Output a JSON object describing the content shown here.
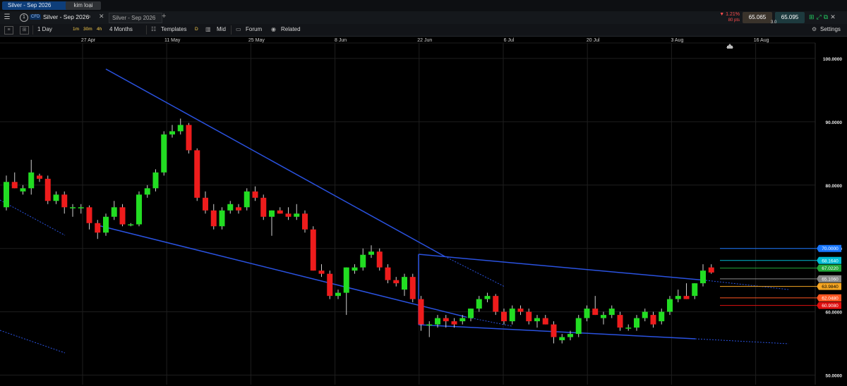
{
  "tabs": {
    "active": "Silver - Sep 2026",
    "inactive": "kim loại"
  },
  "header": {
    "menu_icon": "menu-icon",
    "info_label": "1",
    "instrument_type": "CFD",
    "instrument": "Silver - Sep 2026",
    "compare_placeholder": "Silver - Sep 2026",
    "change_pct": "▼ 1.21%",
    "change_pts": "80 pts",
    "bid": "65.065",
    "ask": "65.095",
    "spread": "3.0"
  },
  "toolbar": {
    "interval": "1 Day",
    "tf_1m": "1m",
    "tf_30m": "30m",
    "tf_4h": "4h",
    "range": "4 Months",
    "templates": "Templates",
    "d_label": "D",
    "mid": "Mid",
    "forum": "Forum",
    "related": "Related",
    "settings": "Settings"
  },
  "colors": {
    "up": "#22dd22",
    "down": "#ee1c1c",
    "trend": "#2a52e0",
    "grid": "#1e1e1e"
  },
  "chart_data": {
    "type": "candlestick",
    "x_ticks": [
      "27 Apr",
      "11 May",
      "25 May",
      "8 Jun",
      "22 Jun",
      "6 Jul",
      "20 Jul",
      "3 Aug",
      "16 Aug"
    ],
    "y_ticks": [
      "100.0000",
      "90.0000",
      "80.0000",
      "70.0000",
      "60.0000",
      "50.0000"
    ],
    "ylim": [
      48.5,
      102
    ],
    "candles": [
      {
        "o": 76.5,
        "h": 81.5,
        "l": 76.0,
        "c": 80.5
      },
      {
        "o": 80.5,
        "h": 82.0,
        "l": 79.5,
        "c": 79.5
      },
      {
        "o": 79.0,
        "h": 80.0,
        "l": 78.5,
        "c": 79.5
      },
      {
        "o": 79.5,
        "h": 84.0,
        "l": 78.5,
        "c": 82.0
      },
      {
        "o": 81.5,
        "h": 81.8,
        "l": 80.5,
        "c": 81.0
      },
      {
        "o": 81.0,
        "h": 81.5,
        "l": 77.0,
        "c": 77.5
      },
      {
        "o": 77.5,
        "h": 79.0,
        "l": 77.0,
        "c": 78.5
      },
      {
        "o": 78.5,
        "h": 79.0,
        "l": 75.5,
        "c": 76.5
      },
      {
        "o": 76.5,
        "h": 77.0,
        "l": 75.0,
        "c": 76.5
      },
      {
        "o": 76.5,
        "h": 77.0,
        "l": 75.5,
        "c": 76.5
      },
      {
        "o": 76.5,
        "h": 76.8,
        "l": 73.0,
        "c": 74.0
      },
      {
        "o": 74.0,
        "h": 74.5,
        "l": 71.5,
        "c": 72.5
      },
      {
        "o": 72.5,
        "h": 75.5,
        "l": 72.0,
        "c": 75.0
      },
      {
        "o": 75.0,
        "h": 77.5,
        "l": 74.5,
        "c": 76.5
      },
      {
        "o": 76.5,
        "h": 77.0,
        "l": 73.5,
        "c": 73.8
      },
      {
        "o": 73.8,
        "h": 74.0,
        "l": 73.5,
        "c": 73.8
      },
      {
        "o": 73.8,
        "h": 79.0,
        "l": 73.5,
        "c": 78.5
      },
      {
        "o": 78.5,
        "h": 80.0,
        "l": 78.0,
        "c": 79.5
      },
      {
        "o": 79.5,
        "h": 82.5,
        "l": 79.0,
        "c": 82.0
      },
      {
        "o": 82.0,
        "h": 88.5,
        "l": 81.5,
        "c": 88.0
      },
      {
        "o": 88.0,
        "h": 89.5,
        "l": 87.5,
        "c": 88.5
      },
      {
        "o": 88.5,
        "h": 90.5,
        "l": 88.0,
        "c": 89.5
      },
      {
        "o": 89.5,
        "h": 89.8,
        "l": 85.0,
        "c": 85.5
      },
      {
        "o": 85.5,
        "h": 85.8,
        "l": 77.5,
        "c": 78.0
      },
      {
        "o": 78.0,
        "h": 79.0,
        "l": 75.5,
        "c": 76.0
      },
      {
        "o": 76.0,
        "h": 77.0,
        "l": 73.0,
        "c": 73.5
      },
      {
        "o": 73.5,
        "h": 76.5,
        "l": 73.0,
        "c": 76.0
      },
      {
        "o": 76.0,
        "h": 77.5,
        "l": 75.5,
        "c": 77.0
      },
      {
        "o": 76.5,
        "h": 77.0,
        "l": 75.5,
        "c": 76.0
      },
      {
        "o": 76.5,
        "h": 79.5,
        "l": 76.0,
        "c": 79.0
      },
      {
        "o": 79.0,
        "h": 79.8,
        "l": 77.5,
        "c": 78.0
      },
      {
        "o": 78.0,
        "h": 78.5,
        "l": 74.5,
        "c": 75.0
      },
      {
        "o": 75.0,
        "h": 76.0,
        "l": 72.0,
        "c": 76.0
      },
      {
        "o": 76.0,
        "h": 76.5,
        "l": 75.5,
        "c": 75.5
      },
      {
        "o": 75.5,
        "h": 76.5,
        "l": 74.5,
        "c": 75.0
      },
      {
        "o": 75.0,
        "h": 77.0,
        "l": 74.5,
        "c": 75.5
      },
      {
        "o": 75.5,
        "h": 76.0,
        "l": 72.5,
        "c": 73.0
      },
      {
        "o": 73.0,
        "h": 73.5,
        "l": 66.5,
        "c": 66.5
      },
      {
        "o": 66.5,
        "h": 67.5,
        "l": 65.5,
        "c": 66.0
      },
      {
        "o": 66.0,
        "h": 66.5,
        "l": 62.0,
        "c": 62.5
      },
      {
        "o": 62.5,
        "h": 63.5,
        "l": 62.0,
        "c": 63.0
      },
      {
        "o": 63.0,
        "h": 67.0,
        "l": 59.5,
        "c": 67.0
      },
      {
        "o": 66.5,
        "h": 67.5,
        "l": 66.0,
        "c": 67.0
      },
      {
        "o": 67.0,
        "h": 70.0,
        "l": 66.5,
        "c": 69.0
      },
      {
        "o": 69.0,
        "h": 70.5,
        "l": 68.5,
        "c": 69.5
      },
      {
        "o": 69.5,
        "h": 70.0,
        "l": 66.5,
        "c": 67.0
      },
      {
        "o": 67.0,
        "h": 67.5,
        "l": 64.5,
        "c": 65.0
      },
      {
        "o": 65.0,
        "h": 65.5,
        "l": 64.0,
        "c": 64.5
      },
      {
        "o": 63.5,
        "h": 66.0,
        "l": 62.5,
        "c": 65.5
      },
      {
        "o": 65.5,
        "h": 66.0,
        "l": 61.5,
        "c": 62.0
      },
      {
        "o": 62.0,
        "h": 62.5,
        "l": 57.0,
        "c": 58.0
      },
      {
        "o": 58.0,
        "h": 58.5,
        "l": 56.0,
        "c": 58.0
      },
      {
        "o": 58.0,
        "h": 59.5,
        "l": 57.5,
        "c": 59.0
      },
      {
        "o": 59.0,
        "h": 59.5,
        "l": 57.5,
        "c": 58.5
      },
      {
        "o": 58.5,
        "h": 59.0,
        "l": 57.5,
        "c": 58.0
      },
      {
        "o": 58.5,
        "h": 59.5,
        "l": 58.0,
        "c": 59.0
      },
      {
        "o": 59.0,
        "h": 60.5,
        "l": 58.5,
        "c": 60.5
      },
      {
        "o": 60.5,
        "h": 62.5,
        "l": 60.0,
        "c": 62.0
      },
      {
        "o": 62.0,
        "h": 63.0,
        "l": 61.5,
        "c": 62.5
      },
      {
        "o": 62.5,
        "h": 62.8,
        "l": 59.5,
        "c": 60.0
      },
      {
        "o": 60.0,
        "h": 60.5,
        "l": 58.0,
        "c": 58.5
      },
      {
        "o": 58.5,
        "h": 61.0,
        "l": 58.0,
        "c": 60.5
      },
      {
        "o": 60.5,
        "h": 61.0,
        "l": 59.5,
        "c": 60.0
      },
      {
        "o": 60.0,
        "h": 60.5,
        "l": 58.0,
        "c": 58.5
      },
      {
        "o": 58.5,
        "h": 59.5,
        "l": 57.5,
        "c": 59.0
      },
      {
        "o": 59.0,
        "h": 59.5,
        "l": 58.0,
        "c": 58.0
      },
      {
        "o": 58.0,
        "h": 58.5,
        "l": 55.0,
        "c": 56.0
      },
      {
        "o": 55.5,
        "h": 56.5,
        "l": 55.0,
        "c": 56.0
      },
      {
        "o": 56.0,
        "h": 57.0,
        "l": 55.5,
        "c": 56.5
      },
      {
        "o": 56.5,
        "h": 59.5,
        "l": 56.0,
        "c": 59.0
      },
      {
        "o": 59.0,
        "h": 61.0,
        "l": 58.5,
        "c": 60.5
      },
      {
        "o": 60.5,
        "h": 62.5,
        "l": 59.5,
        "c": 59.5
      },
      {
        "o": 59.0,
        "h": 60.0,
        "l": 58.0,
        "c": 59.5
      },
      {
        "o": 59.5,
        "h": 61.0,
        "l": 59.0,
        "c": 60.5
      },
      {
        "o": 59.5,
        "h": 60.0,
        "l": 57.0,
        "c": 57.5
      },
      {
        "o": 57.5,
        "h": 58.0,
        "l": 57.0,
        "c": 57.5
      },
      {
        "o": 57.5,
        "h": 59.5,
        "l": 57.0,
        "c": 59.0
      },
      {
        "o": 59.0,
        "h": 60.5,
        "l": 58.5,
        "c": 60.0
      },
      {
        "o": 59.5,
        "h": 60.0,
        "l": 57.5,
        "c": 58.0
      },
      {
        "o": 58.5,
        "h": 60.5,
        "l": 58.0,
        "c": 60.0
      },
      {
        "o": 60.0,
        "h": 62.5,
        "l": 59.5,
        "c": 62.0
      },
      {
        "o": 62.0,
        "h": 63.5,
        "l": 61.5,
        "c": 62.5
      },
      {
        "o": 62.5,
        "h": 64.5,
        "l": 62.0,
        "c": 62.0
      },
      {
        "o": 62.5,
        "h": 64.5,
        "l": 62.0,
        "c": 64.5
      },
      {
        "o": 64.5,
        "h": 67.5,
        "l": 64.0,
        "c": 66.5
      },
      {
        "o": 67.0,
        "h": 67.5,
        "l": 66.0,
        "c": 66.2
      }
    ],
    "price_tags": [
      {
        "label": "70.0000",
        "value": 70.0,
        "color": "#1877ff",
        "text": "#ffffff"
      },
      {
        "label": "68.1640",
        "value": 68.1,
        "color": "#00bcd4",
        "text": "#ffffff"
      },
      {
        "label": "67.0220",
        "value": 66.9,
        "color": "#22a83a",
        "text": "#ffffff"
      },
      {
        "label": "65.1060",
        "value": 65.2,
        "color": "#888888",
        "text": "#ffffff"
      },
      {
        "label": "63.9840",
        "value": 64.0,
        "color": "#f5a623",
        "text": "#000000"
      },
      {
        "label": "62.0480",
        "value": 62.2,
        "color": "#ff5722",
        "text": "#ffffff"
      },
      {
        "label": "60.9080",
        "value": 61.0,
        "color": "#e01010",
        "text": "#ffffff"
      }
    ]
  }
}
